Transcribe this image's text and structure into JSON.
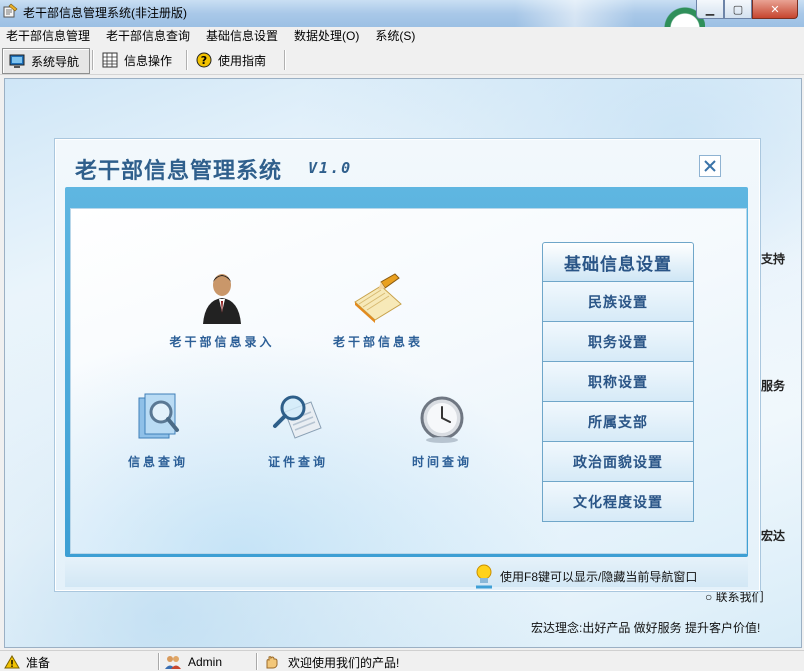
{
  "window": {
    "title": "老干部信息管理系统(非注册版)"
  },
  "menu": [
    "老干部信息管理",
    "老干部信息查询",
    "基础信息设置",
    "数据处理(O)",
    "系统(S)"
  ],
  "toolbar": {
    "nav": "系统导航",
    "ops": "信息操作",
    "guide": "使用指南"
  },
  "panel": {
    "title": "老干部信息管理系统",
    "version": "V1.0",
    "functions": {
      "entry": "老干部信息录入",
      "table": "老干部信息表",
      "query": "信息查询",
      "cert": "证件查询",
      "time": "时间查询"
    },
    "settings": {
      "header": "基础信息设置",
      "items": [
        "民族设置",
        "职务设置",
        "职称设置",
        "所属支部",
        "政治面貌设置",
        "文化程度设置"
      ]
    },
    "hint": "使用F8键可以显示/隐藏当前导航窗口"
  },
  "background": {
    "side_labels": [
      "支持",
      "服务",
      "宏达"
    ],
    "contact": "○ 联系我们",
    "slogan": "宏达理念:出好产品  做好服务  提升客户价值!"
  },
  "status": {
    "ready": "准备",
    "user": "Admin",
    "welcome": "欢迎使用我们的产品!"
  },
  "colors": {
    "accent": "#2c5f97",
    "frame": "#4aa8d8"
  }
}
